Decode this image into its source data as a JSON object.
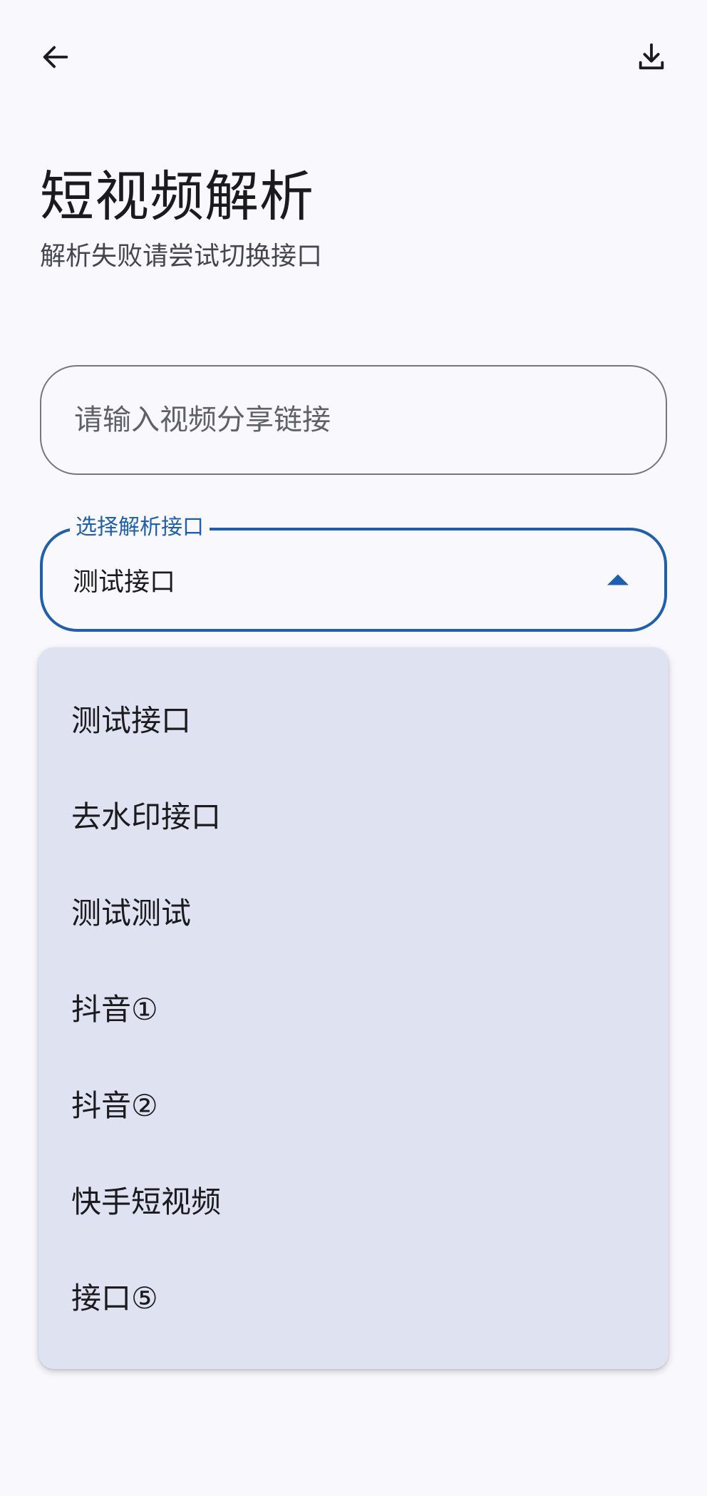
{
  "header": {
    "back_icon": "arrow-left-icon",
    "download_icon": "download-icon"
  },
  "page": {
    "title": "短视频解析",
    "subtitle": "解析失败请尝试切换接口"
  },
  "url_input": {
    "placeholder": "请输入视频分享链接",
    "value": ""
  },
  "interface_select": {
    "label": "选择解析接口",
    "selected": "测试接口",
    "caret_icon": "caret-up-icon",
    "accent_color": "#1d5fb0"
  },
  "menu": {
    "items": [
      {
        "label": "测试接口"
      },
      {
        "label": "去水印接口"
      },
      {
        "label": "测试测试"
      },
      {
        "label": "抖音①"
      },
      {
        "label": "抖音②"
      },
      {
        "label": "快手短视频"
      },
      {
        "label": "接口⑤"
      }
    ]
  }
}
